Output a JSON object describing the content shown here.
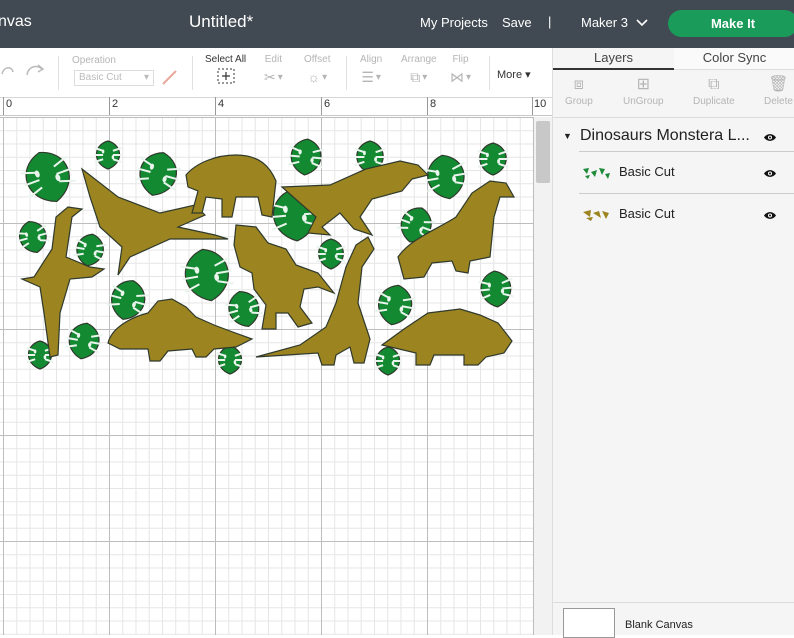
{
  "header": {
    "canvas_label": "nvas",
    "doc_title": "Untitled*",
    "my_projects": "My Projects",
    "save": "Save",
    "separator": "|",
    "machine": "Maker 3",
    "make_it": "Make It",
    "colors": {
      "bar": "#414a52",
      "make_it": "#1a9b5a"
    }
  },
  "toolbar": {
    "operation_label": "Operation",
    "operation_value": "Basic Cut",
    "select_all": "Select All",
    "edit": "Edit",
    "offset": "Offset",
    "align": "Align",
    "arrange": "Arrange",
    "flip": "Flip",
    "more": "More"
  },
  "ruler": {
    "labels": [
      "0",
      "2",
      "4",
      "6",
      "8",
      "10"
    ]
  },
  "panel": {
    "tabs": [
      "Layers",
      "Color Sync"
    ],
    "tools": [
      "Group",
      "UnGroup",
      "Duplicate",
      "Delete"
    ],
    "group_name": "Dinosaurs Monstera L...",
    "layers": [
      {
        "name": "Basic Cut",
        "thumb_color": "#1e8a3a"
      },
      {
        "name": "Basic Cut",
        "thumb_color": "#9c8420"
      }
    ],
    "blank_canvas": "Blank Canvas"
  },
  "design": {
    "leaf_color": "#138a32",
    "dino_color": "#9c8420",
    "outline_color": "#2f3a2c"
  }
}
